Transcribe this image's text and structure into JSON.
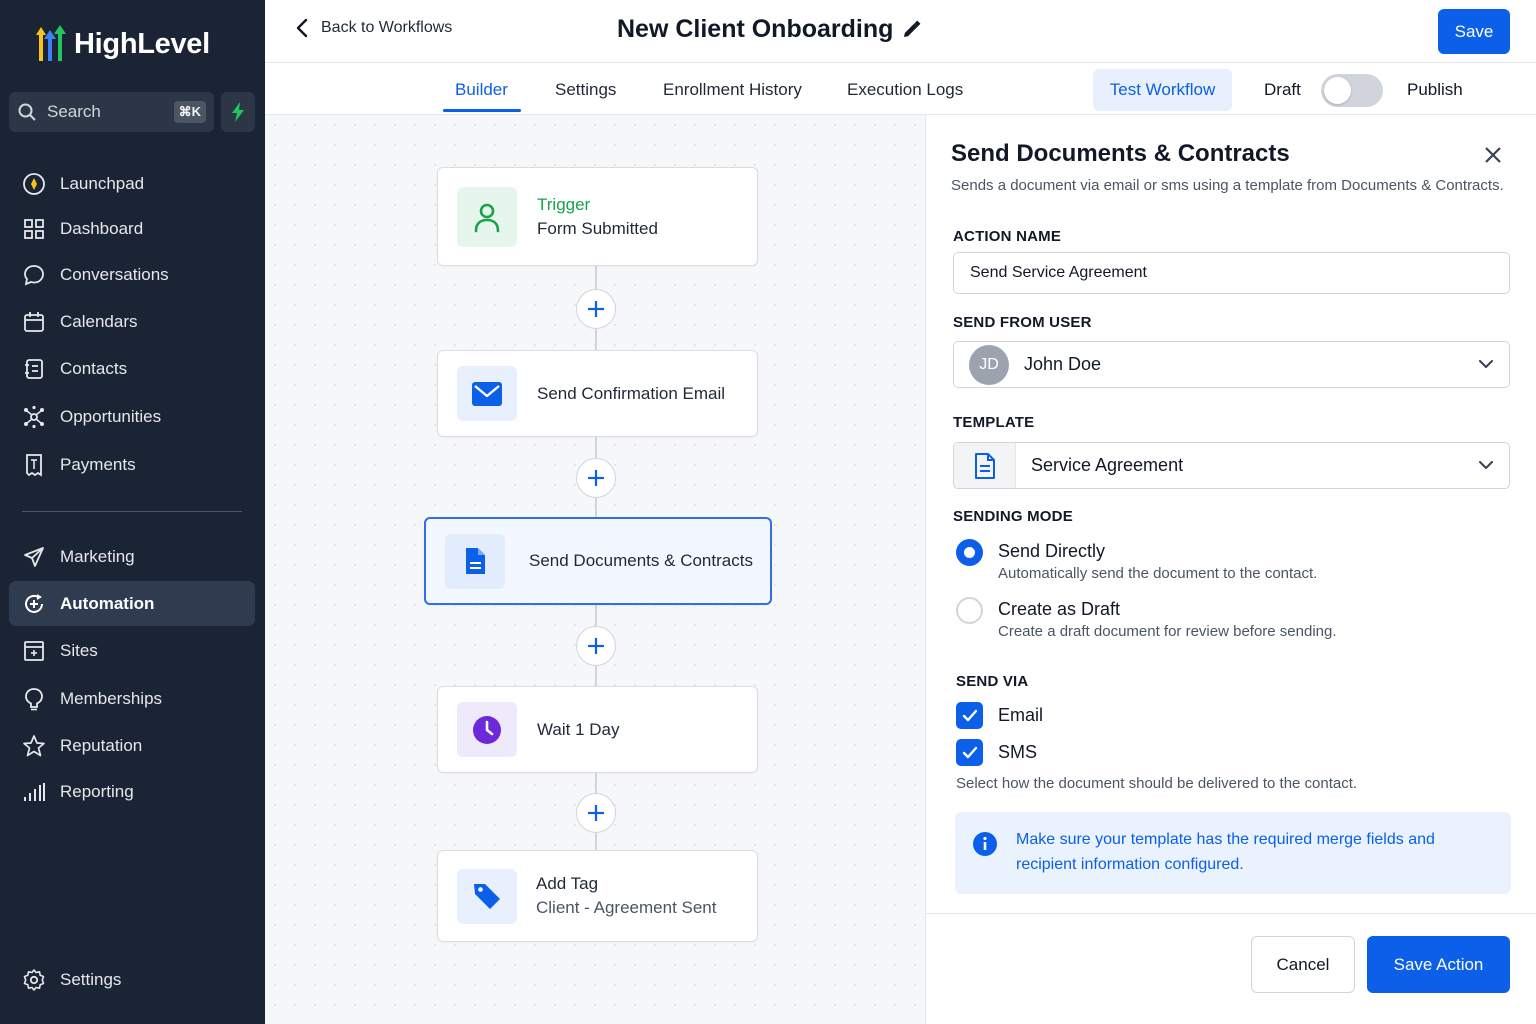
{
  "app": {
    "brand": "HighLevel"
  },
  "search": {
    "label": "Search",
    "shortcut": "⌘K"
  },
  "sidebar": {
    "items": [
      {
        "label": "Launchpad",
        "icon": "launchpad-icon"
      },
      {
        "label": "Dashboard",
        "icon": "dashboard-icon"
      },
      {
        "label": "Conversations",
        "icon": "chat-bubble-icon"
      },
      {
        "label": "Calendars",
        "icon": "calendar-icon"
      },
      {
        "label": "Contacts",
        "icon": "contacts-icon"
      },
      {
        "label": "Opportunities",
        "icon": "opportunities-icon"
      },
      {
        "label": "Payments",
        "icon": "payments-icon"
      },
      {
        "label": "Marketing",
        "icon": "send-icon"
      },
      {
        "label": "Automation",
        "icon": "automation-icon",
        "active": true
      },
      {
        "label": "Sites",
        "icon": "sites-icon"
      },
      {
        "label": "Memberships",
        "icon": "memberships-icon"
      },
      {
        "label": "Reputation",
        "icon": "star-icon"
      },
      {
        "label": "Reporting",
        "icon": "bar-chart-icon"
      },
      {
        "label": "Settings",
        "icon": "gear-icon"
      }
    ]
  },
  "header": {
    "back_label": "Back to Workflows",
    "title": "New Client Onboarding",
    "save_label": "Save"
  },
  "tabs": {
    "items": [
      {
        "label": "Builder",
        "active": true
      },
      {
        "label": "Settings"
      },
      {
        "label": "Enrollment History"
      },
      {
        "label": "Execution Logs"
      }
    ],
    "test_label": "Test Workflow",
    "draft_label": "Draft",
    "publish_label": "Publish",
    "published": false
  },
  "workflow": {
    "trigger": {
      "title": "Trigger",
      "subtitle": "Form Submitted"
    },
    "steps": [
      {
        "label": "Send Confirmation Email",
        "icon": "mail-icon"
      },
      {
        "label": "Send Documents & Contracts",
        "icon": "document-icon",
        "selected": true
      },
      {
        "label": "Wait 1 Day",
        "icon": "clock-icon"
      }
    ],
    "add_tag": {
      "title": "Add Tag",
      "subtitle": "Client - Agreement Sent"
    }
  },
  "panel": {
    "title": "Send Documents & Contracts",
    "description": "Sends a document via email or sms using a template from Documents & Contracts.",
    "action_name_label": "ACTION NAME",
    "action_name_value": "Send Service Agreement",
    "send_from_label": "SEND FROM USER",
    "user_initials": "JD",
    "user_name": "John Doe",
    "template_label": "TEMPLATE",
    "template_value": "Service Agreement",
    "sending_mode_label": "SENDING MODE",
    "modes": [
      {
        "title": "Send Directly",
        "desc": "Automatically send the document to the contact.",
        "selected": true
      },
      {
        "title": "Create as Draft",
        "desc": "Create a draft document for review before sending.",
        "selected": false
      }
    ],
    "send_via_label": "SEND VIA",
    "channels": [
      {
        "label": "Email",
        "checked": true
      },
      {
        "label": "SMS",
        "checked": true
      }
    ],
    "send_via_help": "Select how the document should be delivered to the contact.",
    "info": "Make sure your template has the required merge fields and recipient information configured.",
    "cancel_label": "Cancel",
    "save_label": "Save Action"
  },
  "colors": {
    "sidebar_bg": "#1b2434",
    "primary": "#0b5fe8",
    "trigger_green": "#16a34a",
    "wait_purple": "#6d28d9"
  }
}
